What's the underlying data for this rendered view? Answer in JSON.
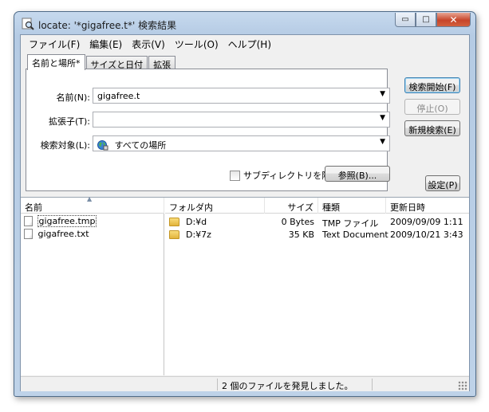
{
  "window": {
    "title": "locate: '*gigafree.t*' 検索結果",
    "caption": {
      "minimize": "▭",
      "maximize": "□",
      "close": "✕"
    }
  },
  "menu": [
    "ファイル(F)",
    "編集(E)",
    "表示(V)",
    "ツール(O)",
    "ヘルプ(H)"
  ],
  "tabs": [
    {
      "label": "名前と場所*",
      "active": true
    },
    {
      "label": "サイズと日付",
      "active": false
    },
    {
      "label": "拡張",
      "active": false
    }
  ],
  "form": {
    "name_label": "名前(N):",
    "name_value": "gigafree.t",
    "ext_label": "拡張子(T):",
    "ext_value": "",
    "target_label": "検索対象(L):",
    "target_value": "すべての場所",
    "subdir_label": "サブディレクトリを除外",
    "browse_label": "参照(B)..."
  },
  "side_buttons": {
    "start": "検索開始(F)",
    "stop": "停止(O)",
    "new_search": "新規検索(E)",
    "settings": "設定(P)"
  },
  "list": {
    "columns": {
      "name": "名前",
      "folder": "フォルダ内",
      "size": "サイズ",
      "type": "種類",
      "modified": "更新日時"
    },
    "rows": [
      {
        "name": "gigafree.tmp",
        "folder": "D:¥d",
        "size": "0 Bytes",
        "type": "TMP ファイル",
        "modified": "2009/09/09 1:11"
      },
      {
        "name": "gigafree.txt",
        "folder": "D:¥7z",
        "size": "35 KB",
        "type": "Text Document",
        "modified": "2009/10/21 3:43"
      }
    ]
  },
  "status": {
    "message": "2 個のファイルを発見しました。"
  },
  "colors": {
    "title_bar": "#c6d9ee",
    "close_button": "#c7452a",
    "default_button_border": "#3c7fb1"
  },
  "icons": {
    "app": "magnifier-icon",
    "target": "globe-icon",
    "file": "file-icon",
    "folder": "folder-icon"
  }
}
